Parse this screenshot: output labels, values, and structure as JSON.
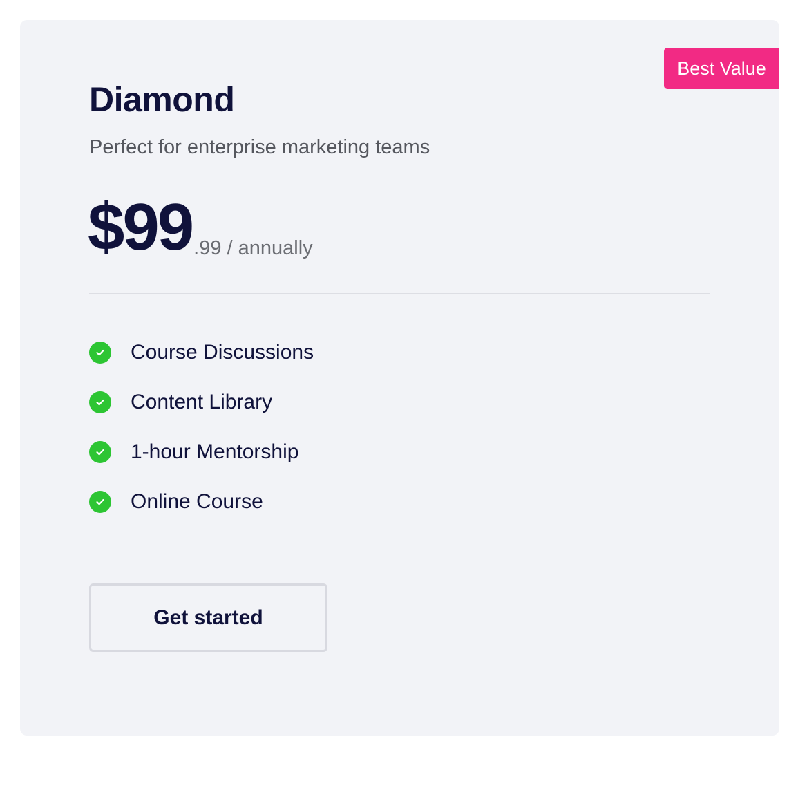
{
  "plan": {
    "badge": "Best Value",
    "name": "Diamond",
    "description": "Perfect for enterprise marketing teams",
    "price_main": "$99",
    "price_sub": ".99 / annually",
    "features": [
      {
        "label": "Course Discussions",
        "icon": "check-circle-icon"
      },
      {
        "label": "Content Library",
        "icon": "check-circle-icon"
      },
      {
        "label": "1-hour Mentorship",
        "icon": "check-circle-icon"
      },
      {
        "label": "Online Course",
        "icon": "check-circle-icon"
      }
    ],
    "cta_label": "Get started"
  },
  "colors": {
    "badge": "#f22a84",
    "check": "#2dc533",
    "heading": "#10123b",
    "card_background": "#f2f3f7"
  }
}
